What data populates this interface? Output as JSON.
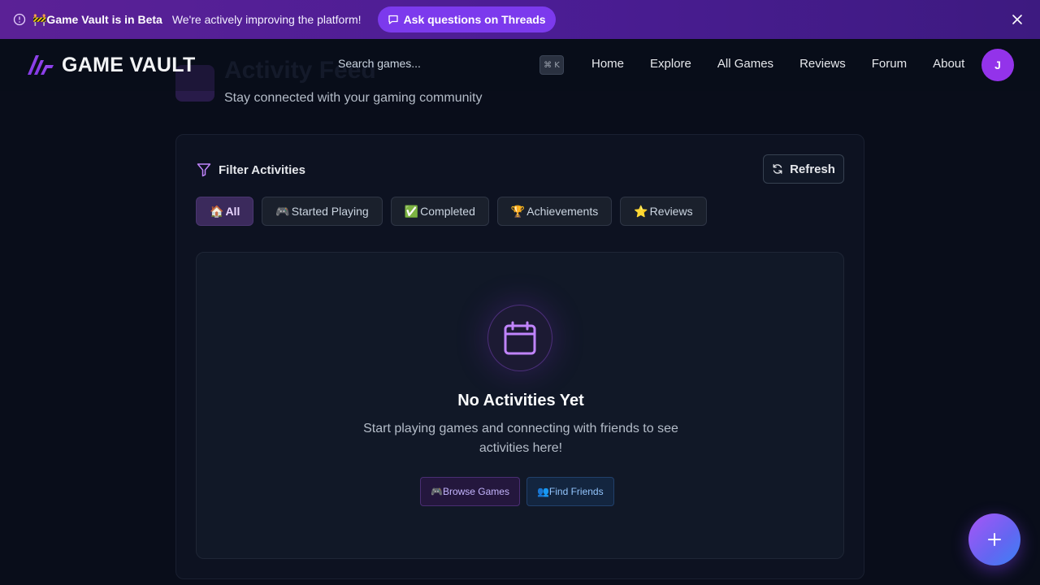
{
  "banner": {
    "title": "🚧Game Vault is in Beta",
    "message": "We're actively improving the platform!",
    "threads_label": "Ask questions on Threads"
  },
  "nav": {
    "brand": "GAME VAULT",
    "search_placeholder": "Search games...",
    "shortcut": "⌘ K",
    "links": [
      "Home",
      "Explore",
      "All Games",
      "Reviews",
      "Forum",
      "About"
    ],
    "avatar_initial": "J"
  },
  "page": {
    "title": "Activity Feed",
    "subtitle": "Stay connected with your gaming community"
  },
  "filters": {
    "heading": "Filter Activities",
    "refresh_label": "Refresh",
    "tabs": [
      {
        "emoji": "🏠",
        "label": "All",
        "active": true
      },
      {
        "emoji": "🎮",
        "label": "Started Playing",
        "active": false
      },
      {
        "emoji": "✅",
        "label": "Completed",
        "active": false
      },
      {
        "emoji": "🏆",
        "label": "Achievements",
        "active": false
      },
      {
        "emoji": "⭐",
        "label": "Reviews",
        "active": false
      }
    ]
  },
  "empty": {
    "title": "No Activities Yet",
    "description": "Start playing games and connecting with friends to see activities here!",
    "browse_label": "🎮Browse Games",
    "friends_label": "👥Find Friends"
  },
  "colors": {
    "accent": "#9333ea",
    "background": "#090d1a",
    "banner": "#4c1d95"
  }
}
